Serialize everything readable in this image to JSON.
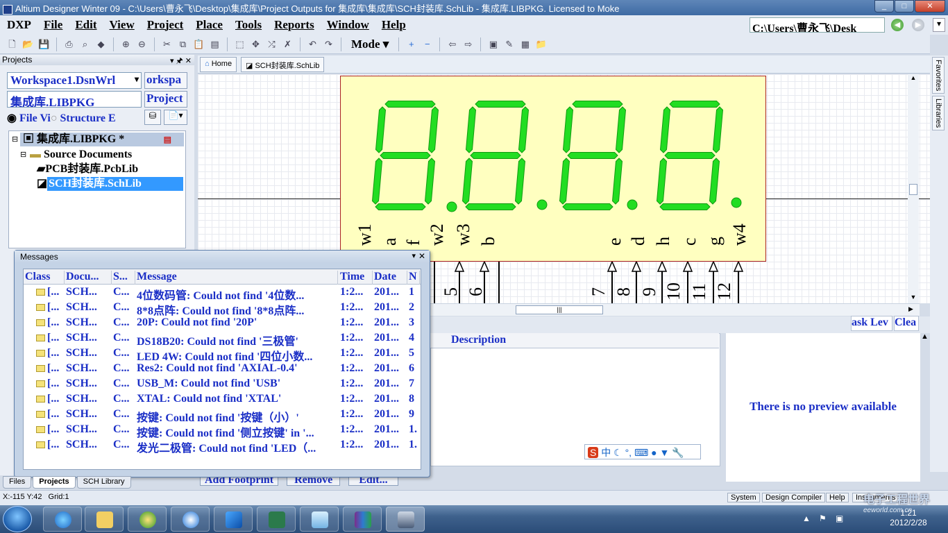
{
  "window": {
    "title": "Altium Designer Winter 09 - C:\\Users\\曹永飞\\Desktop\\集成库\\Project Outputs for 集成库\\集成库\\SCH封装库.SchLib - 集成库.LIBPKG. Licensed to Moke"
  },
  "menu": {
    "items": [
      "DXP",
      "File",
      "Edit",
      "View",
      "Project",
      "Place",
      "Tools",
      "Reports",
      "Window",
      "Help"
    ]
  },
  "path_box": {
    "value": "C:\\Users\\曹永飞\\Desk"
  },
  "toolbar": {
    "mode_label": "Mode"
  },
  "projects_panel": {
    "header": "Projects",
    "workspace_select": "Workspace1.DsnWrl",
    "workspace_button": "orkspa",
    "project_field": "集成库.LIBPKG",
    "project_button": "Project",
    "radio_file_view": "File Vi",
    "radio_structure": "Structure E",
    "tree": {
      "root": "集成库.LIBPKG *",
      "folder": "Source Documents",
      "item_pcb": "PCB封装库.PcbLib",
      "item_sch": "SCH封装库.SchLib"
    }
  },
  "doc_tabs": {
    "home": "Home",
    "schlib": "SCH封装库.SchLib"
  },
  "component": {
    "pin_labels_left": [
      "w1",
      "a",
      "f",
      "w2",
      "w3",
      "b"
    ],
    "pin_labels_right": [
      "e",
      "d",
      "h",
      "c",
      "g",
      "w4"
    ],
    "pin_numbers": [
      "5",
      "6",
      "7",
      "8",
      "9",
      "10",
      "11",
      "12"
    ]
  },
  "side_tabs": {
    "favorites": "Favorites",
    "libraries": "Libraries"
  },
  "lower_panel": {
    "description_header": "Description",
    "mask_level": "ask Lev",
    "clear": "Clea",
    "preview_text": "There is no preview available",
    "buttons": [
      "Add Footprint",
      "Remove",
      "Edit..."
    ]
  },
  "messages": {
    "title": "Messages",
    "columns": [
      "Class",
      "Docu...",
      "S...",
      "Message",
      "Time",
      "Date",
      "N"
    ],
    "rows": [
      {
        "cls": "[...",
        "doc": "SCH...",
        "src": "C...",
        "msg": "4位数码管: Could not find '4位数...",
        "time": "1:2...",
        "date": "201...",
        "n": "1"
      },
      {
        "cls": "[...",
        "doc": "SCH...",
        "src": "C...",
        "msg": "8*8点阵: Could not find '8*8点阵...",
        "time": "1:2...",
        "date": "201...",
        "n": "2"
      },
      {
        "cls": "[...",
        "doc": "SCH...",
        "src": "C...",
        "msg": "20P: Could not find '20P'",
        "time": "1:2...",
        "date": "201...",
        "n": "3"
      },
      {
        "cls": "[...",
        "doc": "SCH...",
        "src": "C...",
        "msg": "DS18B20: Could not find '三极管'",
        "time": "1:2...",
        "date": "201...",
        "n": "4"
      },
      {
        "cls": "[...",
        "doc": "SCH...",
        "src": "C...",
        "msg": "LED 4W: Could not find '四位小数...",
        "time": "1:2...",
        "date": "201...",
        "n": "5"
      },
      {
        "cls": "[...",
        "doc": "SCH...",
        "src": "C...",
        "msg": "Res2: Could not find 'AXIAL-0.4'",
        "time": "1:2...",
        "date": "201...",
        "n": "6"
      },
      {
        "cls": "[...",
        "doc": "SCH...",
        "src": "C...",
        "msg": "USB_M: Could not find 'USB'",
        "time": "1:2...",
        "date": "201...",
        "n": "7"
      },
      {
        "cls": "[...",
        "doc": "SCH...",
        "src": "C...",
        "msg": "XTAL: Could not find 'XTAL'",
        "time": "1:2...",
        "date": "201...",
        "n": "8"
      },
      {
        "cls": "[...",
        "doc": "SCH...",
        "src": "C...",
        "msg": "按键: Could not find '按键（小）'",
        "time": "1:2...",
        "date": "201...",
        "n": "9"
      },
      {
        "cls": "[...",
        "doc": "SCH...",
        "src": "C...",
        "msg": "按键: Could not find '侧立按键' in '...",
        "time": "1:2...",
        "date": "201...",
        "n": "1."
      },
      {
        "cls": "[...",
        "doc": "SCH...",
        "src": "C...",
        "msg": "发光二极管: Could not find 'LED（...",
        "time": "1:2...",
        "date": "201...",
        "n": "1."
      }
    ]
  },
  "bottom_tabs": [
    "Files",
    "Projects",
    "SCH Library"
  ],
  "status": {
    "coords": "X:-115 Y:42",
    "grid": "Grid:1",
    "buttons": [
      "System",
      "Design Compiler",
      "Help",
      "Instruments"
    ]
  },
  "ime": {
    "label": "中"
  },
  "taskbar": {
    "time": "1:21",
    "date": "2012/2/28"
  },
  "watermark": {
    "text": "电子工程世界",
    "sub": "eeworld.com.cn"
  },
  "colors": {
    "segment_green": "#22dd22",
    "component_fill": "#ffffc0",
    "link_blue": "#1a2ec6",
    "selection": "#3399ff"
  }
}
